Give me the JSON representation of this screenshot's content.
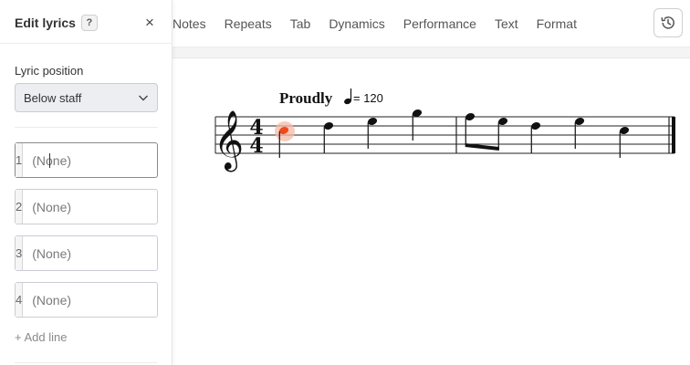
{
  "panel": {
    "title": "Edit lyrics",
    "help_label": "?",
    "close_label": "×",
    "position_label": "Lyric position",
    "position_value": "Below staff",
    "lines": [
      {
        "number": "1",
        "placeholder": "(None)",
        "active": true
      },
      {
        "number": "2",
        "placeholder": "(None)"
      },
      {
        "number": "3",
        "placeholder": "(None)"
      },
      {
        "number": "4",
        "placeholder": "(None)"
      }
    ],
    "add_line_label": "+ Add line"
  },
  "toolbar": {
    "tabs": [
      "Notes",
      "Repeats",
      "Tab",
      "Dynamics",
      "Performance",
      "Text",
      "Format"
    ]
  },
  "score": {
    "tempo_text": "Proudly",
    "tempo_value": "= 120",
    "time_signature_top": "4",
    "time_signature_bottom": "4"
  },
  "colors": {
    "selected_note": "#ef4a1f",
    "selected_halo": "#f7b9a5"
  }
}
